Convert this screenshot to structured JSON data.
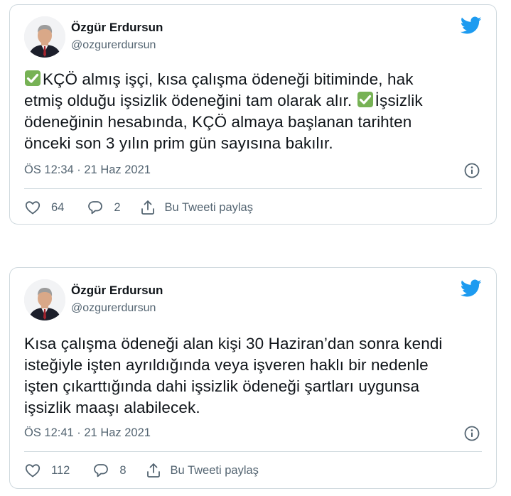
{
  "tweets": [
    {
      "author_name": "Özgür Erdursun",
      "author_handle": "@ozgurerdursun",
      "text_lines": [
        "KÇÖ almış işçi, kısa çalışma ödeneği bitiminde, hak",
        "etmiş olduğu işsizlik ödeneğini tam olarak alır. ",
        "İşsizlik",
        "ödeneğinin hesabında, KÇÖ almaya başlanan tarihten",
        "önceki son 3 yılın prim gün sayısına bakılır."
      ],
      "timestamp": "ÖS 12:34 · 21 Haz 2021",
      "likes": "64",
      "replies": "2",
      "share_label": "Bu Tweeti paylaş"
    },
    {
      "author_name": "Özgür Erdursun",
      "author_handle": "@ozgurerdursun",
      "text_lines": [
        "Kısa çalışma ödeneği alan kişi 30 Haziran’dan sonra kendi",
        "isteğiyle işten ayrıldığında veya işveren haklı bir nedenle",
        "işten çıkarttığında dahi işsizlik ödeneği şartları uygunsa",
        "işsizlik maaşı alabilecek."
      ],
      "timestamp": "ÖS 12:41 · 21 Haz 2021",
      "likes": "112",
      "replies": "8",
      "share_label": "Bu Tweeti paylaş"
    }
  ],
  "icons": {
    "brand": "twitter-bird-icon",
    "emoji": "check-mark-button-emoji",
    "info": "info-icon",
    "like": "heart-icon",
    "reply": "reply-bubble-icon",
    "share": "share-icon"
  },
  "colors": {
    "twitter_blue": "#1d9bf0",
    "text_primary": "#0f1419",
    "text_secondary": "#536471",
    "border": "#cfd9de",
    "check_green": "#77b255"
  }
}
